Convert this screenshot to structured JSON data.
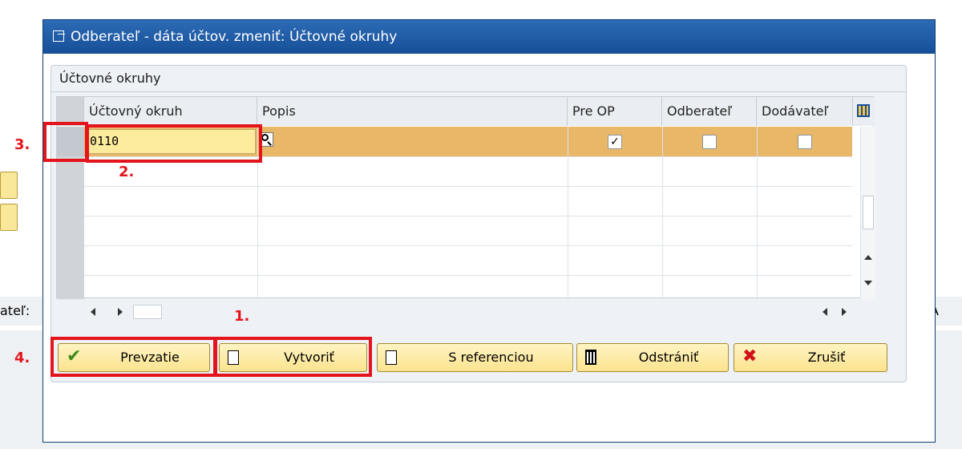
{
  "dialog": {
    "title": "Odberateľ - dáta účtov. zmeniť: Účtovné okruhy",
    "panel_title": "Účtovné okruhy"
  },
  "table": {
    "columns": [
      "Účtovný okruh",
      "Popis",
      "Pre OP",
      "Odberateľ",
      "Dodávateľ"
    ],
    "rows": [
      {
        "company_code": "0110",
        "description": "",
        "pre_op": true,
        "odberatel": false,
        "dodavatel": false
      }
    ]
  },
  "buttons": {
    "prevzatie": "Prevzatie",
    "vytvorit": "Vytvoriť",
    "s_referenciou": "S referenciou",
    "odstranit": "Odstrániť",
    "zrusit": "Zrušiť"
  },
  "annotations": [
    "1.",
    "2.",
    "3.",
    "4."
  ],
  "background": {
    "left_label": "ateľ:",
    "right_label": "A"
  },
  "colors": {
    "title_bar": "#1d5aa6",
    "selected_row": "#e8b768",
    "button": "#fbe38e",
    "annotation": "#e3141c"
  }
}
